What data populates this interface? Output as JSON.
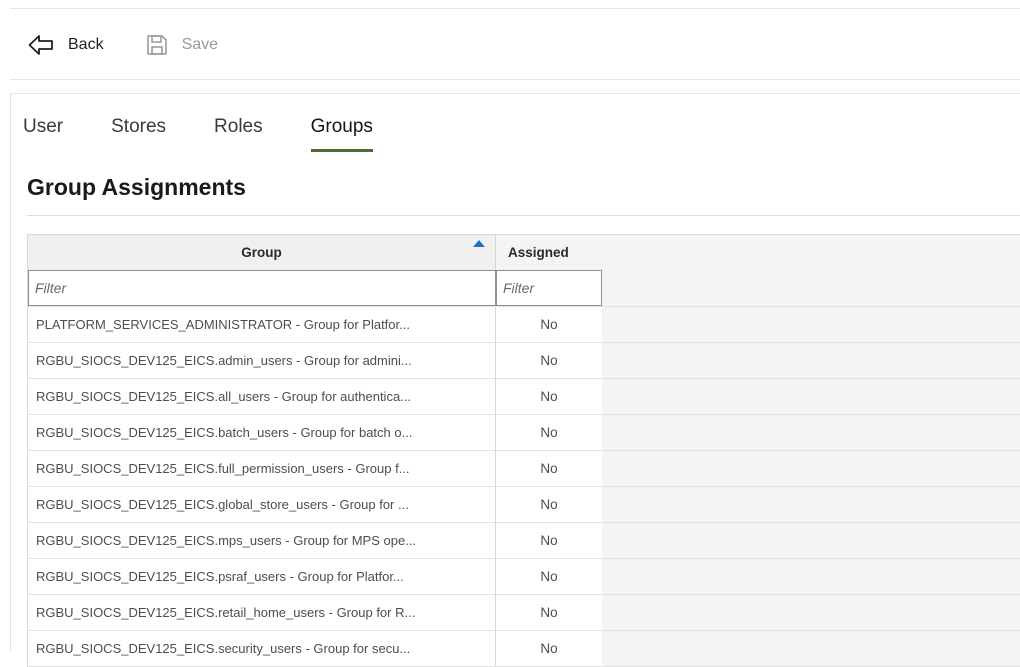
{
  "toolbar": {
    "back_label": "Back",
    "save_label": "Save"
  },
  "tabs": [
    {
      "label": "User",
      "active": false
    },
    {
      "label": "Stores",
      "active": false
    },
    {
      "label": "Roles",
      "active": false
    },
    {
      "label": "Groups",
      "active": true
    }
  ],
  "section_title": "Group Assignments",
  "grid": {
    "columns": {
      "group": "Group",
      "assigned": "Assigned"
    },
    "sort": {
      "column": "group",
      "direction": "ascending"
    },
    "filter_placeholder": "Filter",
    "rows": [
      {
        "group": "PLATFORM_SERVICES_ADMINISTRATOR - Group for Platfor...",
        "assigned": "No"
      },
      {
        "group": "RGBU_SIOCS_DEV125_EICS.admin_users - Group for admini...",
        "assigned": "No"
      },
      {
        "group": "RGBU_SIOCS_DEV125_EICS.all_users - Group for authentica...",
        "assigned": "No"
      },
      {
        "group": "RGBU_SIOCS_DEV125_EICS.batch_users - Group for batch o...",
        "assigned": "No"
      },
      {
        "group": "RGBU_SIOCS_DEV125_EICS.full_permission_users - Group f...",
        "assigned": "No"
      },
      {
        "group": "RGBU_SIOCS_DEV125_EICS.global_store_users - Group for ...",
        "assigned": "No"
      },
      {
        "group": "RGBU_SIOCS_DEV125_EICS.mps_users - Group for MPS ope...",
        "assigned": "No"
      },
      {
        "group": "RGBU_SIOCS_DEV125_EICS.psraf_users - Group for Platfor...",
        "assigned": "No"
      },
      {
        "group": "RGBU_SIOCS_DEV125_EICS.retail_home_users - Group for R...",
        "assigned": "No"
      },
      {
        "group": "RGBU_SIOCS_DEV125_EICS.security_users - Group for secu...",
        "assigned": "No"
      }
    ]
  },
  "colors": {
    "active_tab_underline": "#4f6b3a",
    "sort_indicator": "#1a73c9"
  },
  "icons": {
    "back": "arrow-left-outline-icon",
    "save": "floppy-disk-icon"
  }
}
